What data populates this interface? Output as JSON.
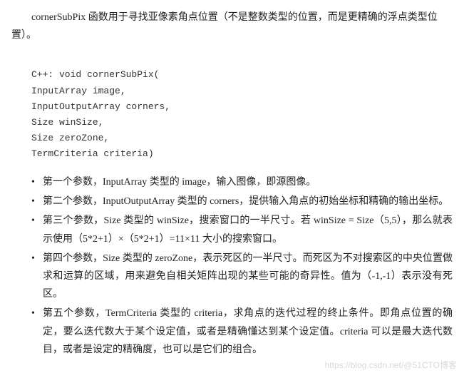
{
  "intro": "cornerSubPix 函数用于寻找亚像素角点位置（不是整数类型的位置，而是更精确的浮点类型位置）。",
  "code": {
    "line1": "C++: void cornerSubPix(",
    "line2": "InputArray image,",
    "line3": " InputOutputArray corners,",
    "line4": " Size winSize,",
    "line5": " Size zeroZone,",
    "line6": " TermCriteria criteria)"
  },
  "bullets": [
    "第一个参数，InputArray 类型的 image，输入图像，即源图像。",
    "第二个参数，InputOutputArray 类型的 corners，提供输入角点的初始坐标和精确的输出坐标。",
    "第三个参数，Size 类型的 winSize，搜索窗口的一半尺寸。若 winSize = Size（5,5），那么就表示使用（5*2+1）×（5*2+1）=11×11 大小的搜索窗口。",
    "第四个参数，Size 类型的 zeroZone，表示死区的一半尺寸。而死区为不对搜索区的中央位置做求和运算的区域，用来避免自相关矩阵出现的某些可能的奇异性。值为（-1,-1）表示没有死区。",
    "第五个参数，TermCriteria 类型的 criteria，求角点的迭代过程的终止条件。即角点位置的确定，要么迭代数大于某个设定值，或者是精确懂达到某个设定值。criteria 可以是最大迭代数目，或者是设定的精确度，也可以是它们的组合。"
  ],
  "watermark": "https://blog.csdn.net/@51CTO博客"
}
